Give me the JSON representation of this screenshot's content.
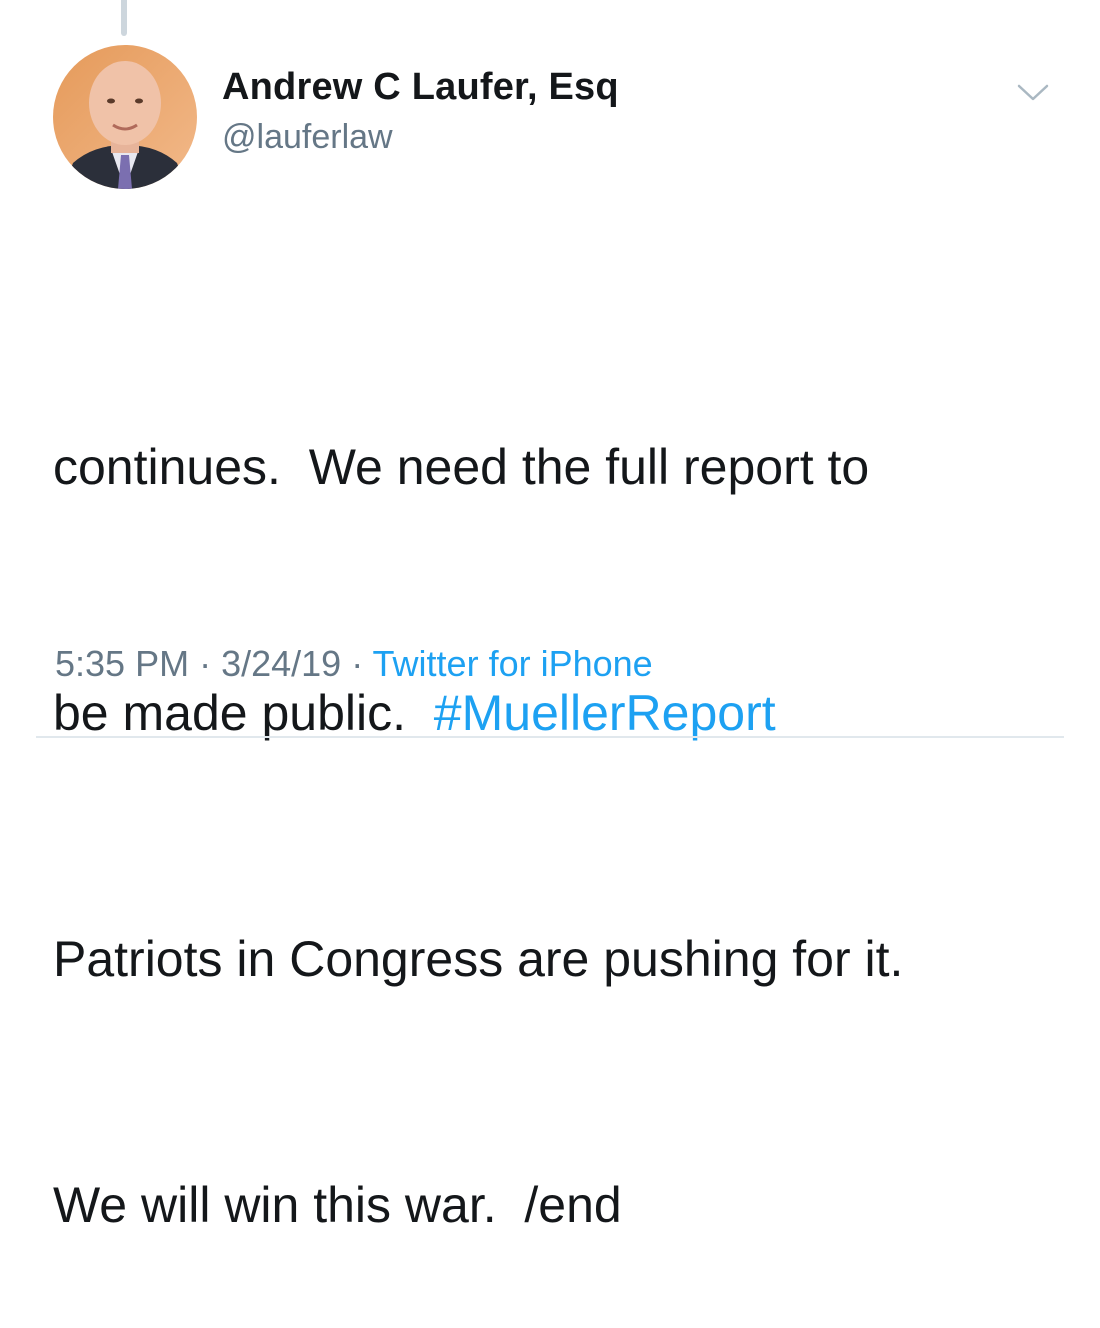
{
  "user": {
    "display_name": "Andrew C Laufer, Esq",
    "handle": "@lauferlaw",
    "avatar_icon": "profile-photo"
  },
  "tweet": {
    "line1": "continues.  We need the full report to",
    "line2_prefix": "be made public.  ",
    "hashtag": "#MuellerReport",
    "line3": "Patriots in Congress are pushing for it.",
    "line4": "We will win this war.  /end"
  },
  "meta": {
    "time": "5:35 PM",
    "separator": " · ",
    "date": "3/24/19",
    "source": "Twitter for iPhone"
  },
  "icons": {
    "more": "chevron-down-icon"
  },
  "colors": {
    "text": "#14171a",
    "secondary": "#657786",
    "link": "#1da1f2",
    "divider": "#e1e8ed"
  }
}
